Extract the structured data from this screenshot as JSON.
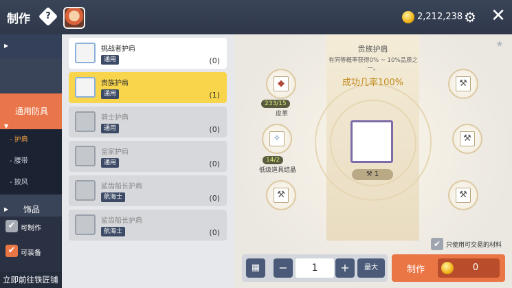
{
  "header": {
    "title": "制作",
    "help_icon": "?",
    "gold_amount": "2,212,238"
  },
  "sidebar": {
    "categories": [
      {
        "label": "通用防具",
        "active": true
      },
      {
        "label": "饰品",
        "active": false
      }
    ],
    "sub_items": [
      {
        "label": "- 护肩",
        "active": true
      },
      {
        "label": "- 腰带",
        "active": false
      },
      {
        "label": "- 披风",
        "active": false
      }
    ],
    "filters": [
      {
        "label": "可制作",
        "checked": false
      },
      {
        "label": "可装备",
        "checked": true
      }
    ],
    "smithy_link": "立即前往铁匠铺"
  },
  "items": [
    {
      "name": "挑战者护肩",
      "tag": "通用",
      "count": "(0)",
      "state": "normal"
    },
    {
      "name": "贵族护肩",
      "tag": "通用",
      "count": "(1)",
      "state": "selected"
    },
    {
      "name": "骑士护肩",
      "tag": "通用",
      "count": "(0)",
      "state": "dim"
    },
    {
      "name": "皇家护肩",
      "tag": "通用",
      "count": "(0)",
      "state": "dim"
    },
    {
      "name": "鲨齿船长护肩",
      "tag": "航海士",
      "count": "(0)",
      "state": "dim"
    },
    {
      "name": "鲨齿船长护肩",
      "tag": "航海士",
      "count": "(0)",
      "state": "dim"
    }
  ],
  "recipe": {
    "title": "贵族护肩",
    "desc": "有同等概率获得0% ~ 10%品质之一。",
    "success_rate": "成功几率100%",
    "materials": [
      {
        "name": "皮革",
        "qty": "233/15"
      },
      {
        "name": "低级道具结晶",
        "qty": "14/2"
      }
    ],
    "result_count": "1",
    "trade_only_label": "只使用可交易的材料"
  },
  "controls": {
    "quantity": "1",
    "max_label": "最大",
    "craft_label": "制作",
    "craft_cost": "0"
  },
  "colors": {
    "accent_orange": "#ea7646",
    "selected_yellow": "#f8d54a",
    "tag_navy": "#3c4a66"
  }
}
